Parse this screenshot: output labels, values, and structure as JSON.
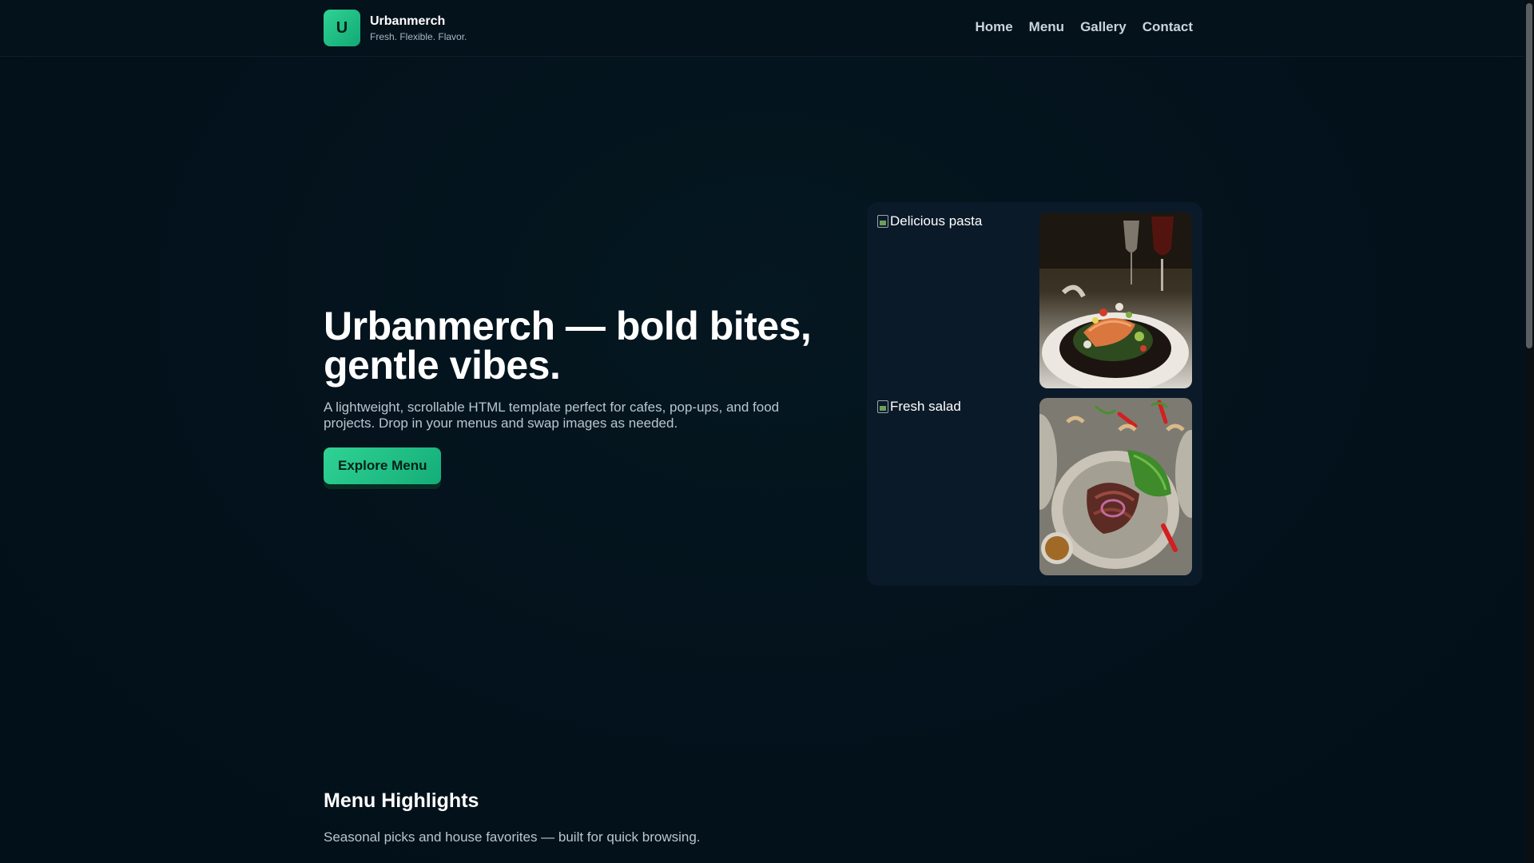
{
  "brand": {
    "logo_letter": "U",
    "name": "Urbanmerch",
    "tagline": "Fresh. Flexible. Flavor."
  },
  "nav": {
    "items": [
      "Home",
      "Menu",
      "Gallery",
      "Contact"
    ]
  },
  "hero": {
    "title": "Urbanmerch — bold bites, gentle vibes.",
    "subtitle": "A lightweight, scrollable HTML template perfect for cafes, pop-ups, and food projects. Drop in your menus and swap images as needed.",
    "cta_label": "Explore Menu"
  },
  "gallery": {
    "image1_alt": "Delicious pasta",
    "image2_alt": "Fresh salad"
  },
  "highlights": {
    "title": "Menu Highlights",
    "subtitle": "Seasonal picks and house favorites — built for quick browsing."
  },
  "colors": {
    "accent": "#2fd394",
    "background": "#03111b",
    "card": "#0b1a29"
  }
}
